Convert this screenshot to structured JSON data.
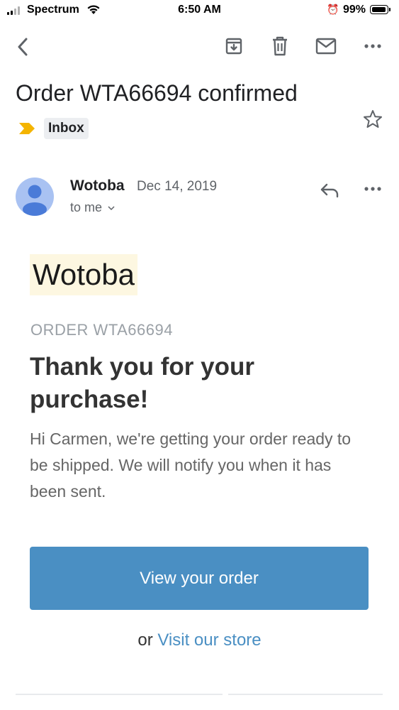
{
  "status_bar": {
    "carrier": "Spectrum",
    "time": "6:50 AM",
    "battery_percent_label": "99%",
    "battery_level": 0.99
  },
  "toolbar": {
    "icons": [
      "back-icon",
      "archive-icon",
      "delete-icon",
      "mark-unread-icon",
      "more-icon"
    ]
  },
  "email": {
    "subject": "Order WTA66694 confirmed",
    "label": "Inbox",
    "label_color": "#f4b400",
    "sender": "Wotoba",
    "date": "Dec 14, 2019",
    "recipient": "to me",
    "avatar_color": "#a9c2f2"
  },
  "message": {
    "brand": "Wotoba",
    "order_number": "ORDER WTA66694",
    "headline": "Thank you for your purchase!",
    "body": "Hi Carmen, we're getting your order ready to be shipped. We will notify you when it has been sent.",
    "button_label": "View your order",
    "button_color": "#4a8fc3",
    "alt_prefix": "or",
    "alt_link": "Visit our store"
  }
}
